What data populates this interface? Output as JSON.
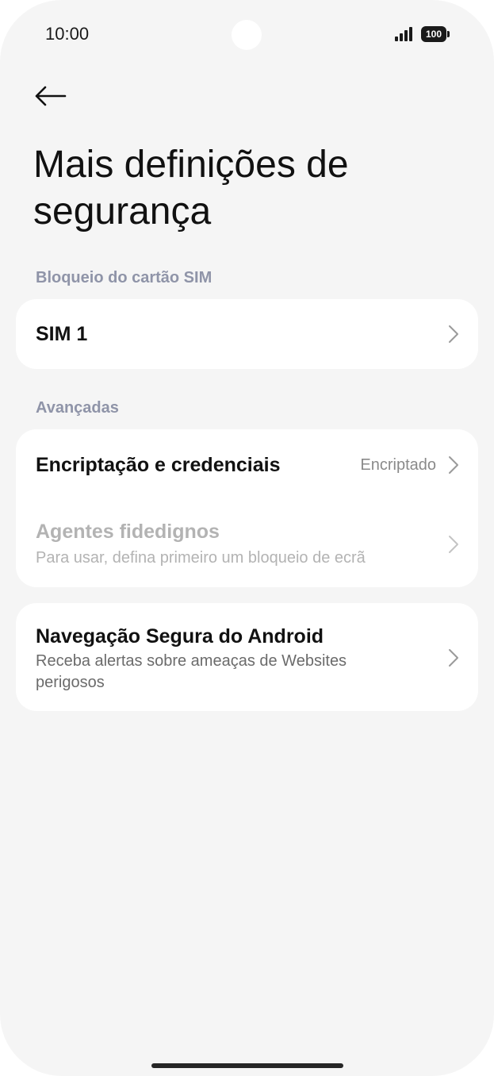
{
  "status_bar": {
    "time": "10:00",
    "battery": "100"
  },
  "icons": {
    "back": "back-arrow-icon",
    "chevron": "chevron-right-icon",
    "signal": "signal-icon",
    "battery": "battery-icon"
  },
  "page": {
    "title": "Mais definições de segurança"
  },
  "sections": {
    "sim_lock": {
      "header": "Bloqueio do cartão SIM",
      "items": [
        {
          "title": "SIM 1"
        }
      ]
    },
    "advanced": {
      "header": "Avançadas",
      "items": [
        {
          "title": "Encriptação e credenciais",
          "value": "Encriptado",
          "enabled": true
        },
        {
          "title": "Agentes fidedignos",
          "subtitle": "Para usar, defina primeiro um bloqueio de ecrã",
          "enabled": false
        }
      ]
    },
    "safe_browsing": {
      "items": [
        {
          "title": "Navegação Segura do Android",
          "subtitle": "Receba alertas sobre ameaças de Websites perigosos"
        }
      ]
    }
  },
  "colors": {
    "background": "#f5f5f5",
    "card": "#ffffff",
    "section_header": "#8f94a8",
    "disabled_text": "#b3b3b3"
  }
}
